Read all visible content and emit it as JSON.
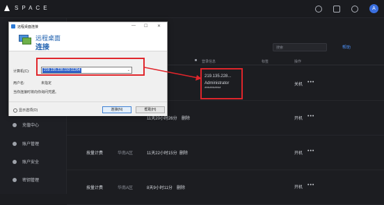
{
  "app": {
    "logo_text": "SPACE"
  },
  "topbar": {
    "avatar_letter": "A"
  },
  "sidebar": {
    "items": [
      "充值中心",
      "账户管理",
      "账户安全",
      "密钥管理"
    ]
  },
  "main": {
    "search_placeholder": "搜索",
    "help_link": "帮助",
    "columns": [
      "登录信息",
      "标签",
      "操作"
    ],
    "rows": [
      {
        "login_ip": "219.135.228...",
        "login_user": "Administrator",
        "login_pass": "**********",
        "status": "关机",
        "actions": "•••"
      },
      {
        "name": "",
        "region": "",
        "expire": "11天20小时26分",
        "delete": "删除",
        "status": "开机",
        "actions": "•••"
      },
      {
        "name": "按量计费",
        "region": "华南A区",
        "expire": "11天22小时15分",
        "delete": "删除",
        "status": "开机",
        "actions": "•••"
      },
      {
        "name": "按量计费",
        "region": "华南A区",
        "expire": "8天9小时11分",
        "delete": "删除",
        "status": "开机",
        "actions": "•••"
      }
    ]
  },
  "dialog": {
    "title": "远程桌面连接",
    "heading_line1": "远程桌面",
    "heading_line2": "连接",
    "computer_label": "计算机(C):",
    "computer_value": "219.135.228.193:11264",
    "username_label": "用户名:",
    "username_value": "未指定",
    "hint": "当你连接时将向你询问凭据。",
    "options_label": "显示选项(O)",
    "connect_button": "连接(N)",
    "help_button": "帮助(H)"
  },
  "colors": {
    "annotation": "#e0252b",
    "accent": "#3a6fe0",
    "link": "#4c8ff4"
  }
}
